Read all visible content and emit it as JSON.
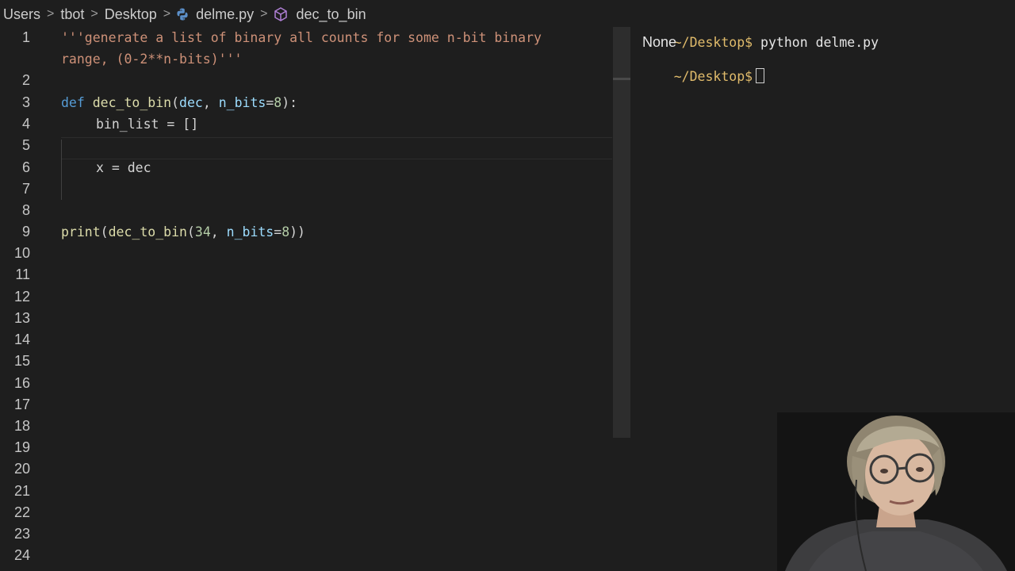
{
  "breadcrumb": {
    "items": [
      "Users",
      "tbot",
      "Desktop"
    ],
    "file": "delme.py",
    "symbol": "dec_to_bin",
    "separator": ">"
  },
  "editor": {
    "line_numbers": [
      "1",
      "2",
      "3",
      "4",
      "5",
      "6",
      "7",
      "8",
      "9",
      "10",
      "11",
      "12",
      "13",
      "14",
      "15",
      "16",
      "17",
      "18",
      "19",
      "20",
      "21",
      "22",
      "23",
      "24"
    ],
    "line1": "'''generate a list of binary all counts for some n-bit binary",
    "line1_wrap": "range, (0-2**n-bits)'''",
    "line3": {
      "kw": "def",
      "fn": "dec_to_bin",
      "open": "(",
      "p1": "dec",
      "comma": ", ",
      "p2": "n_bits",
      "eq": "=",
      "num": "8",
      "close": "):"
    },
    "line4": "bin_list = []",
    "line6": "x = dec",
    "line9": {
      "fn1": "print",
      "open1": "(",
      "fn2": "dec_to_bin",
      "open2": "(",
      "num1": "34",
      "comma": ", ",
      "p": "n_bits",
      "eq": "=",
      "num2": "8",
      "close": "))"
    }
  },
  "terminal": {
    "prompt": "~/Desktop$",
    "command": " python delme.py",
    "output": "None"
  },
  "colors": {
    "keyword": "#569cd6",
    "function": "#dcdcaa",
    "parameter": "#9cdcfe",
    "number": "#b5cea8",
    "string": "#ce9178",
    "prompt": "#e0bb6b"
  }
}
